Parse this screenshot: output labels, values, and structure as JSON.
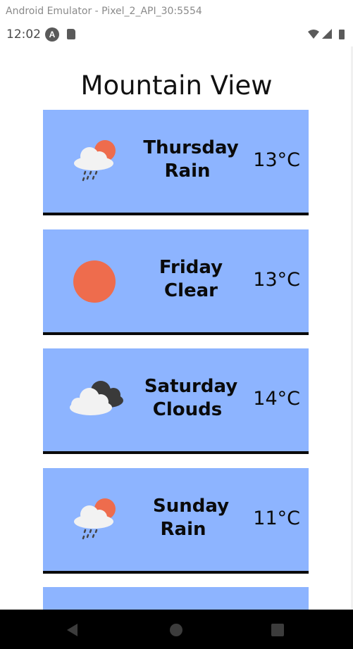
{
  "window": {
    "title": "Android Emulator - Pixel_2_API_30:5554"
  },
  "status": {
    "time": "12:02"
  },
  "app": {
    "title": "Mountain View"
  },
  "forecast": [
    {
      "day": "Thursday",
      "desc": "Rain",
      "temp": "13°C",
      "icon": "rain-icon"
    },
    {
      "day": "Friday",
      "desc": "Clear",
      "temp": "13°C",
      "icon": "sun-icon"
    },
    {
      "day": "Saturday",
      "desc": "Clouds",
      "temp": "14°C",
      "icon": "clouds-icon"
    },
    {
      "day": "Sunday",
      "desc": "Rain",
      "temp": "11°C",
      "icon": "rain-icon"
    }
  ],
  "colors": {
    "card": "#8db4ff",
    "sun": "#ee6c4d",
    "cloud": "#f2f2f2",
    "dark_cloud": "#3a3a3a"
  }
}
